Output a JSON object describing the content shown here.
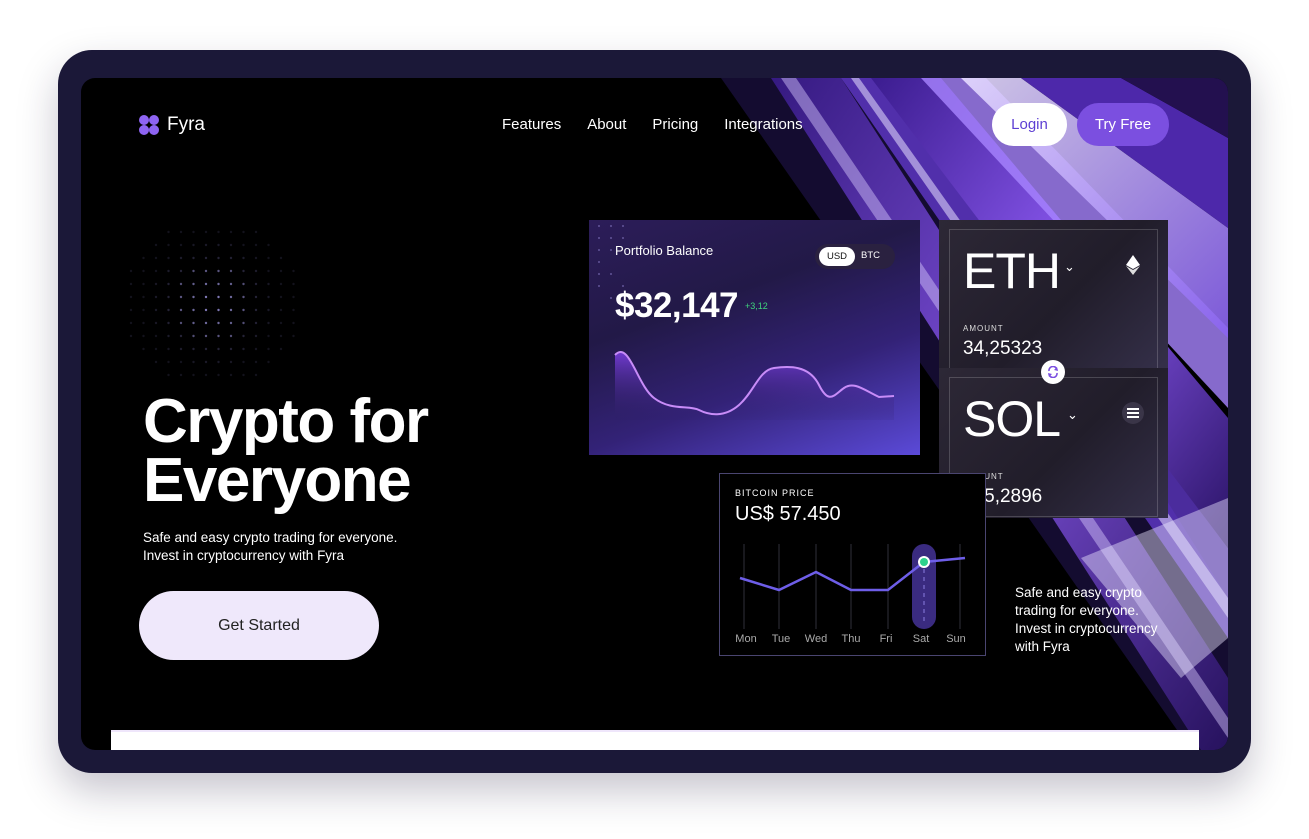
{
  "brand": {
    "name": "Fyra",
    "accent": "#8e64f2"
  },
  "nav": {
    "items": [
      "Features",
      "About",
      "Pricing",
      "Integrations"
    ]
  },
  "header": {
    "login_label": "Login",
    "try_label": "Try Free"
  },
  "hero": {
    "title": "Crypto for\nEveryone",
    "subtitle": "Safe and easy crypto trading for everyone.\nInvest in cryptocurrency with Fyra",
    "cta_label": "Get Started"
  },
  "portfolio": {
    "label": "Portfolio Balance",
    "currency_active": "USD",
    "currency_other": "BTC",
    "amount": "$32,147",
    "change": "+3,12"
  },
  "coins": [
    {
      "symbol": "ETH",
      "amount_label": "AMOUNT",
      "amount": "34,25323",
      "icon": "ethereum-icon"
    },
    {
      "symbol": "SOL",
      "amount_label": "AMOUNT",
      "amount": "265,2896",
      "icon": "solana-icon"
    }
  ],
  "bitcoin": {
    "label": "BITCOIN PRICE",
    "price": "US$ 57.450",
    "days": [
      "Mon",
      "Tue",
      "Wed",
      "Thu",
      "Fri",
      "Sat",
      "Sun"
    ],
    "selected_day": "Sat"
  },
  "side_text": "Safe and easy crypto\ntrading for everyone.\nInvest in cryptocurrency\nwith Fyra",
  "colors": {
    "primary": "#7b4fe0",
    "cta_bg": "#efe8fb",
    "positive": "#3fd47d",
    "frame": "#1b1838"
  }
}
